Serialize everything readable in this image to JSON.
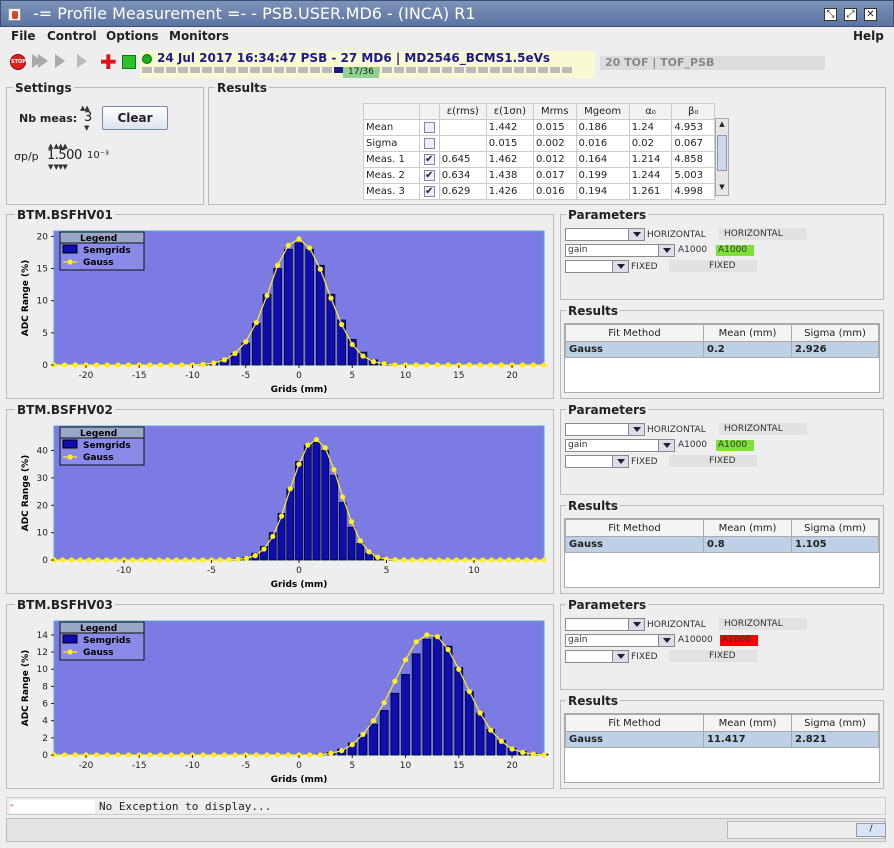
{
  "window": {
    "title": "-= Profile Measurement =- - PSB.USER.MD6 - (INCA)  R1"
  },
  "menu": {
    "file": "File",
    "control": "Control",
    "options": "Options",
    "monitors": "Monitors",
    "help": "Help"
  },
  "toolbar": {
    "stop_label": "STOP",
    "cycle_text": "24 Jul 2017  16:34:47  PSB - 27 MD6 | MD2546_BCMS1.5eVs",
    "cycle_progress": "17/36",
    "cycle_progress_fraction": 0.472,
    "tof_label": "20 TOF | TOF_PSB"
  },
  "settings": {
    "title": "Settings",
    "nb_meas_label": "Nb meas:",
    "nb_meas_value": "3",
    "clear_label": "Clear",
    "dp_label": "σp/p",
    "dp_value": "1.500",
    "dp_exp": "10⁻³"
  },
  "results": {
    "title": "Results",
    "headers": [
      "",
      "",
      "ε(rms)",
      "ε(1σn)",
      "Mrms",
      "Mgeom",
      "α₀",
      "β₀"
    ],
    "rows": [
      {
        "name": "Mean",
        "checked": false,
        "erms": "",
        "e1s": "1.442",
        "mrms": "0.015",
        "mgeom": "0.186",
        "alpha": "1.24",
        "beta": "4.953"
      },
      {
        "name": "Sigma",
        "checked": false,
        "erms": "",
        "e1s": "0.015",
        "mrms": "0.002",
        "mgeom": "0.016",
        "alpha": "0.02",
        "beta": "0.067"
      },
      {
        "name": "Meas. 1",
        "checked": true,
        "erms": "0.645",
        "e1s": "1.462",
        "mrms": "0.012",
        "mgeom": "0.164",
        "alpha": "1.214",
        "beta": "4.858"
      },
      {
        "name": "Meas. 2",
        "checked": true,
        "erms": "0.634",
        "e1s": "1.438",
        "mrms": "0.017",
        "mgeom": "0.199",
        "alpha": "1.244",
        "beta": "5.003"
      },
      {
        "name": "Meas. 3",
        "checked": true,
        "erms": "0.629",
        "e1s": "1.426",
        "mrms": "0.016",
        "mgeom": "0.194",
        "alpha": "1.261",
        "beta": "4.998"
      }
    ]
  },
  "panels": [
    {
      "title": "BTM.BSFHV01",
      "params_title": "Parameters",
      "plane": "HORIZONTAL",
      "plane2": "HORIZONTAL",
      "gain_label": "gain",
      "gain_value": "A1000",
      "gain_status": "A1000",
      "gain_color": "#7fe03a",
      "fixed": "FIXED",
      "fixed2": "FIXED",
      "results_title": "Results",
      "fit_headers": [
        "Fit Method",
        "Mean (mm)",
        "Sigma (mm)"
      ],
      "fit_row": [
        "Gauss",
        "0.2",
        "2.926"
      ]
    },
    {
      "title": "BTM.BSFHV02",
      "params_title": "Parameters",
      "plane": "HORIZONTAL",
      "plane2": "HORIZONTAL",
      "gain_label": "gain",
      "gain_value": "A1000",
      "gain_status": "A1000",
      "gain_color": "#7fe03a",
      "fixed": "FIXED",
      "fixed2": "FIXED",
      "results_title": "Results",
      "fit_headers": [
        "Fit Method",
        "Mean (mm)",
        "Sigma (mm)"
      ],
      "fit_row": [
        "Gauss",
        "0.8",
        "1.105"
      ]
    },
    {
      "title": "BTM.BSFHV03",
      "params_title": "Parameters",
      "plane": "HORIZONTAL",
      "plane2": "HORIZONTAL",
      "gain_label": "gain",
      "gain_value": "A10000",
      "gain_status": "A1000",
      "gain_color": "#ff0000",
      "fixed": "FIXED",
      "fixed2": "FIXED",
      "results_title": "Results",
      "fit_headers": [
        "Fit Method",
        "Mean (mm)",
        "Sigma (mm)"
      ],
      "fit_row": [
        "Gauss",
        "11.417",
        "2.821"
      ]
    }
  ],
  "chart_data": [
    {
      "type": "bar",
      "xlabel": "Grids (mm)",
      "ylabel": "ADC Range (%)",
      "xlim": [
        -23,
        23
      ],
      "ylim": [
        0,
        20
      ],
      "xticks": [
        -20,
        -15,
        -10,
        -5,
        0,
        5,
        10,
        15,
        20
      ],
      "yticks": [
        0,
        5,
        10,
        15,
        20
      ],
      "legend": {
        "title": "Legend",
        "entries": [
          "Semgrids",
          "Gauss"
        ],
        "placement": "top-left"
      },
      "bar_width": 0.75,
      "x": [
        -23,
        -22,
        -21,
        -20,
        -19,
        -18,
        -17,
        -16,
        -15,
        -14,
        -13,
        -12,
        -11,
        -10,
        -9,
        -8,
        -7,
        -6,
        -5,
        -4,
        -3,
        -2,
        -1,
        0,
        1,
        2,
        3,
        4,
        5,
        6,
        7,
        8,
        9,
        10,
        11,
        12,
        13,
        14,
        15,
        16,
        17,
        18,
        19,
        20,
        21,
        22,
        23
      ],
      "series": [
        {
          "name": "Semgrids",
          "values": [
            0,
            0,
            0,
            0,
            0,
            0,
            0,
            0,
            0,
            0,
            0,
            0,
            0,
            0,
            0.1,
            0.3,
            0.8,
            1.8,
            3.4,
            6.5,
            11,
            15,
            18,
            19,
            18,
            15.5,
            11,
            7,
            4,
            2,
            0.8,
            0.3,
            0.1,
            0,
            0,
            0,
            0,
            0,
            0,
            0,
            0,
            0,
            0,
            0,
            0,
            0,
            0
          ]
        },
        {
          "name": "Gauss",
          "values": [
            0,
            0,
            0,
            0,
            0,
            0,
            0,
            0,
            0,
            0,
            0,
            0,
            0,
            0,
            0.1,
            0.3,
            0.8,
            1.8,
            3.6,
            6.6,
            10.8,
            15.5,
            18.6,
            19.6,
            18.2,
            14.9,
            10.4,
            6.3,
            3.2,
            1.4,
            0.5,
            0.2,
            0,
            0,
            0,
            0,
            0,
            0,
            0,
            0,
            0,
            0,
            0,
            0,
            0,
            0,
            0
          ]
        }
      ]
    },
    {
      "type": "bar",
      "xlabel": "Grids (mm)",
      "ylabel": "ADC Range (%)",
      "xlim": [
        -14,
        14
      ],
      "ylim": [
        0,
        47
      ],
      "xticks": [
        -10,
        -5,
        0,
        5,
        10
      ],
      "yticks": [
        0,
        10,
        20,
        30,
        40
      ],
      "legend": {
        "title": "Legend",
        "entries": [
          "Semgrids",
          "Gauss"
        ],
        "placement": "top-left"
      },
      "bar_width": 0.4,
      "x": [
        -14,
        -13.5,
        -13,
        -12.5,
        -12,
        -11.5,
        -11,
        -10.5,
        -10,
        -9.5,
        -9,
        -8.5,
        -8,
        -7.5,
        -7,
        -6.5,
        -6,
        -5.5,
        -5,
        -4.5,
        -4,
        -3.5,
        -3,
        -2.5,
        -2,
        -1.5,
        -1,
        -0.5,
        0,
        0.5,
        1,
        1.5,
        2,
        2.5,
        3,
        3.5,
        4,
        4.5,
        5,
        5.5,
        6,
        6.5,
        7,
        7.5,
        8,
        8.5,
        9,
        9.5,
        10,
        10.5,
        11,
        11.5,
        12,
        12.5,
        13,
        13.5,
        14
      ],
      "series": [
        {
          "name": "Semgrids",
          "values": [
            0,
            0,
            0,
            0,
            0,
            0,
            0,
            0,
            0,
            0,
            0,
            0,
            0,
            0,
            0,
            0,
            0,
            0,
            0,
            0,
            0.2,
            0.4,
            1,
            2.5,
            5,
            10,
            17,
            26,
            36,
            42,
            43,
            40,
            31,
            21,
            12,
            6,
            2.5,
            1,
            0.3,
            0.1,
            0,
            0,
            0,
            0,
            0,
            0,
            0,
            0,
            0,
            0,
            0,
            0,
            0,
            0,
            0,
            0,
            0
          ]
        },
        {
          "name": "Gauss",
          "values": [
            0,
            0,
            0,
            0,
            0,
            0,
            0,
            0,
            0,
            0,
            0,
            0,
            0,
            0,
            0,
            0,
            0,
            0,
            0,
            0,
            0.1,
            0.2,
            0.6,
            1.6,
            4,
            8.6,
            16,
            26,
            35,
            42,
            44,
            41,
            33,
            23,
            14,
            7,
            3,
            1,
            0.3,
            0.1,
            0,
            0,
            0,
            0,
            0,
            0,
            0,
            0,
            0,
            0,
            0,
            0,
            0,
            0,
            0,
            0,
            0
          ]
        }
      ]
    },
    {
      "type": "bar",
      "xlabel": "Grids (mm)",
      "ylabel": "ADC Range (%)",
      "xlim": [
        -23,
        23
      ],
      "ylim": [
        0,
        15
      ],
      "xticks": [
        -20,
        -15,
        -10,
        -5,
        0,
        5,
        10,
        15,
        20
      ],
      "yticks": [
        0,
        2,
        4,
        6,
        8,
        10,
        12,
        14
      ],
      "legend": {
        "title": "Legend",
        "entries": [
          "Semgrids",
          "Gauss"
        ],
        "placement": "top-left"
      },
      "bar_width": 0.75,
      "x": [
        -23,
        -22,
        -21,
        -20,
        -19,
        -18,
        -17,
        -16,
        -15,
        -14,
        -13,
        -12,
        -11,
        -10,
        -9,
        -8,
        -7,
        -6,
        -5,
        -4,
        -3,
        -2,
        -1,
        0,
        1,
        2,
        3,
        4,
        5,
        6,
        7,
        8,
        9,
        10,
        11,
        12,
        13,
        14,
        15,
        16,
        17,
        18,
        19,
        20,
        21,
        22,
        23
      ],
      "series": [
        {
          "name": "Semgrids",
          "values": [
            0,
            0,
            0,
            0,
            0,
            0,
            0,
            0,
            0,
            0,
            0,
            0,
            0,
            0,
            0,
            0,
            0,
            0,
            0,
            0,
            0,
            0,
            0,
            0,
            0,
            0.1,
            0.3,
            0.7,
            1.4,
            2.4,
            3.6,
            5.2,
            7.2,
            9.4,
            11.8,
            13.5,
            13.8,
            12.7,
            10.2,
            7.4,
            4.9,
            3,
            1.7,
            0.8,
            0.4,
            0.2,
            0.1
          ]
        },
        {
          "name": "Gauss",
          "values": [
            0,
            0,
            0,
            0,
            0,
            0,
            0,
            0,
            0,
            0,
            0,
            0,
            0,
            0,
            0,
            0,
            0,
            0,
            0,
            0,
            0,
            0,
            0,
            0,
            0,
            0,
            0.2,
            0.5,
            1.2,
            2.4,
            4,
            6.1,
            8.6,
            11.1,
            13.2,
            14,
            13.8,
            12.3,
            10,
            7.4,
            4.9,
            2.9,
            1.6,
            0.7,
            0.3,
            0.1,
            0
          ]
        }
      ]
    }
  ]
}
